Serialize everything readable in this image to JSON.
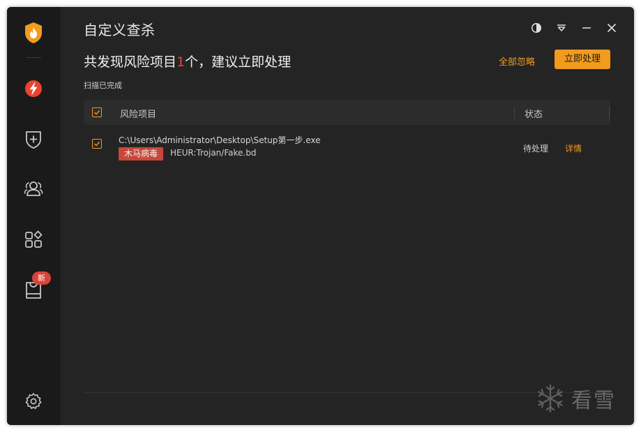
{
  "window": {
    "title": "自定义查杀"
  },
  "sidebar": {
    "items": [
      {
        "name": "logo",
        "icon": "shield-flame-icon"
      },
      {
        "name": "speedup",
        "icon": "lightning-icon"
      },
      {
        "name": "protect",
        "icon": "shield-plus-icon"
      },
      {
        "name": "users",
        "icon": "users-icon"
      },
      {
        "name": "apps",
        "icon": "apps-icon"
      },
      {
        "name": "store",
        "icon": "bag-icon",
        "badge": "新"
      },
      {
        "name": "settings",
        "icon": "gear-icon"
      }
    ]
  },
  "summary": {
    "prefix": "共发现风险项目",
    "count": "1",
    "suffix": "个，建议立即处理",
    "ignore_all": "全部忽略",
    "handle_now": "立即处理",
    "scan_status": "扫描已完成"
  },
  "table": {
    "headers": {
      "item": "风险项目",
      "status": "状态"
    },
    "rows": [
      {
        "path": "C:\\Users\\Administrator\\Desktop\\Setup第一步.exe",
        "tag": "木马病毒",
        "virus": "HEUR:Trojan/Fake.bd",
        "status": "待处理",
        "detail": "详情",
        "checked": true
      }
    ]
  },
  "watermark": {
    "text": "看雪"
  },
  "colors": {
    "accent": "#f29b1d",
    "danger": "#c9473a",
    "bg": "#242424",
    "sidebar": "#1a1a1a"
  }
}
